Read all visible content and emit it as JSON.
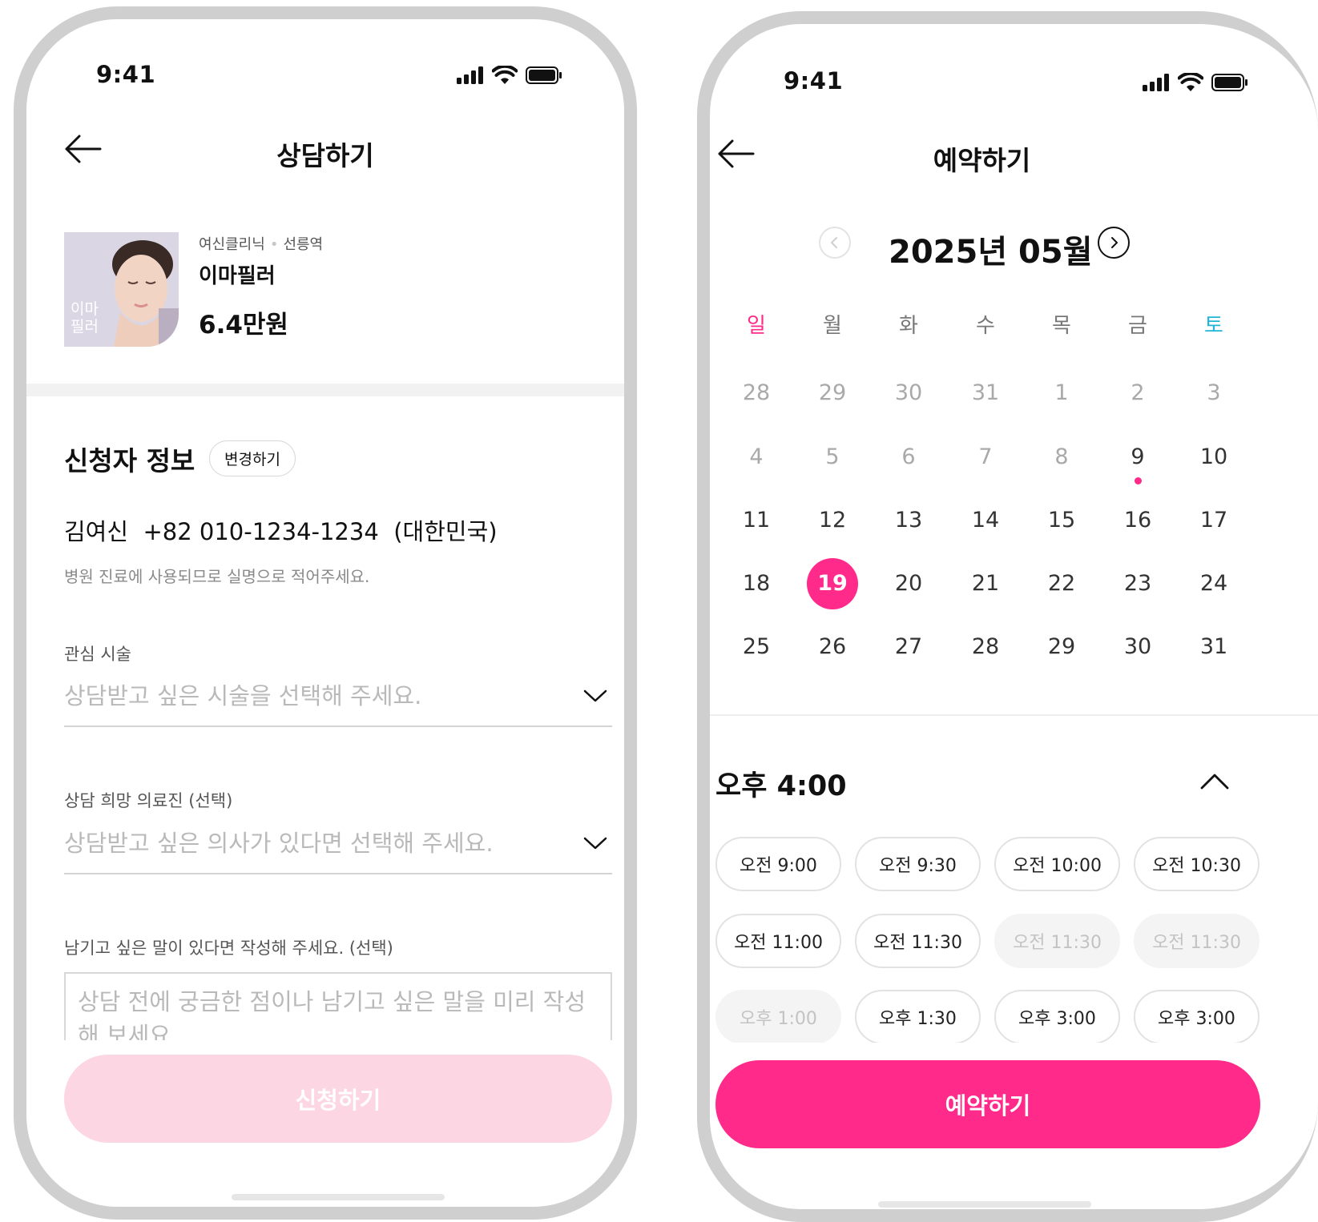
{
  "colors": {
    "accent": "#ff2a8a",
    "accent_disabled": "#fdd6e3",
    "sunday": "#ff2a8a",
    "saturday": "#21b5d8",
    "frame": "#cfcfcf"
  },
  "left_screen": {
    "status": {
      "time": "9:41"
    },
    "nav": {
      "title": "상담하기",
      "back_icon": "arrow-left-icon"
    },
    "product": {
      "image_caption_line1": "이마",
      "image_caption_line2": "필러",
      "clinic": "여신클리닉",
      "location": "선릉역",
      "name": "이마필러",
      "price": "6.4만원"
    },
    "applicant": {
      "title": "신청자 정보",
      "change_button": "변경하기",
      "name": "김여신",
      "phone": "+82 010-1234-1234",
      "country": "(대한민국)",
      "hint": "병원 진료에 사용되므로 실명으로 적어주세요."
    },
    "treatment_field": {
      "label": "관심 시술",
      "placeholder": "상담받고 싶은 시술을 선택해 주세요.",
      "icon": "chevron-down-icon"
    },
    "doctor_field": {
      "label": "상담 희망 의료진 (선택)",
      "placeholder": "상담받고 싶은 의사가 있다면 선택해 주세요.",
      "icon": "chevron-down-icon"
    },
    "message_field": {
      "label": "남기고 싶은 말이 있다면 작성해 주세요. (선택)",
      "placeholder": "상담 전에 궁금한 점이나 남기고 싶은 말을 미리 작성해 보세요."
    },
    "submit_button": "신청하기"
  },
  "right_screen": {
    "status": {
      "time": "9:41"
    },
    "nav": {
      "title": "예약하기",
      "back_icon": "arrow-left-icon"
    },
    "calendar": {
      "month_label": "2025년 05월",
      "prev_icon": "chevron-left-icon",
      "next_icon": "chevron-right-icon",
      "weekdays": [
        "일",
        "월",
        "화",
        "수",
        "목",
        "금",
        "토"
      ],
      "weeks": [
        [
          "28",
          "29",
          "30",
          "31",
          "1",
          "2",
          "3"
        ],
        [
          "4",
          "5",
          "6",
          "7",
          "8",
          "9",
          "10"
        ],
        [
          "11",
          "12",
          "13",
          "14",
          "15",
          "16",
          "17"
        ],
        [
          "18",
          "19",
          "20",
          "21",
          "22",
          "23",
          "24"
        ],
        [
          "25",
          "26",
          "27",
          "28",
          "29",
          "30",
          "31"
        ]
      ],
      "selected_day": "19",
      "event_day": "9"
    },
    "time_section": {
      "selected_time": "오후 4:00",
      "toggle_icon": "chevron-up-icon",
      "slots": [
        {
          "label": "오전 9:00",
          "disabled": false
        },
        {
          "label": "오전 9:30",
          "disabled": false
        },
        {
          "label": "오전 10:00",
          "disabled": false
        },
        {
          "label": "오전 10:30",
          "disabled": false
        },
        {
          "label": "오전 11:00",
          "disabled": false
        },
        {
          "label": "오전 11:30",
          "disabled": false
        },
        {
          "label": "오전 11:30",
          "disabled": true
        },
        {
          "label": "오전 11:30",
          "disabled": true
        },
        {
          "label": "오후 1:00",
          "disabled": true
        },
        {
          "label": "오후 1:30",
          "disabled": false
        },
        {
          "label": "오후 3:00",
          "disabled": false
        },
        {
          "label": "오후 3:00",
          "disabled": false
        }
      ]
    },
    "submit_button": "예약하기"
  }
}
